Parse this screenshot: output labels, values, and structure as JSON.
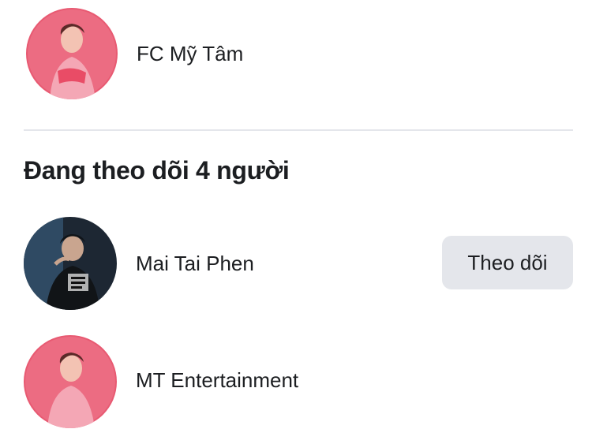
{
  "pages": [
    {
      "name": "FC Mỹ Tâm",
      "avatar_icon": "pink-portrait-avatar"
    }
  ],
  "following": {
    "title": "Đang theo dõi 4 người",
    "items": [
      {
        "name": "Mai Tai Phen",
        "avatar_icon": "dark-portrait-avatar",
        "action_label": "Theo dõi"
      },
      {
        "name": "MT Entertainment",
        "avatar_icon": "pink-portrait-avatar"
      }
    ]
  },
  "colors": {
    "avatar_pink": "#e85a72",
    "avatar_dark": "#1d2733",
    "button_bg": "#e4e6eb",
    "divider": "#e4e6eb"
  }
}
